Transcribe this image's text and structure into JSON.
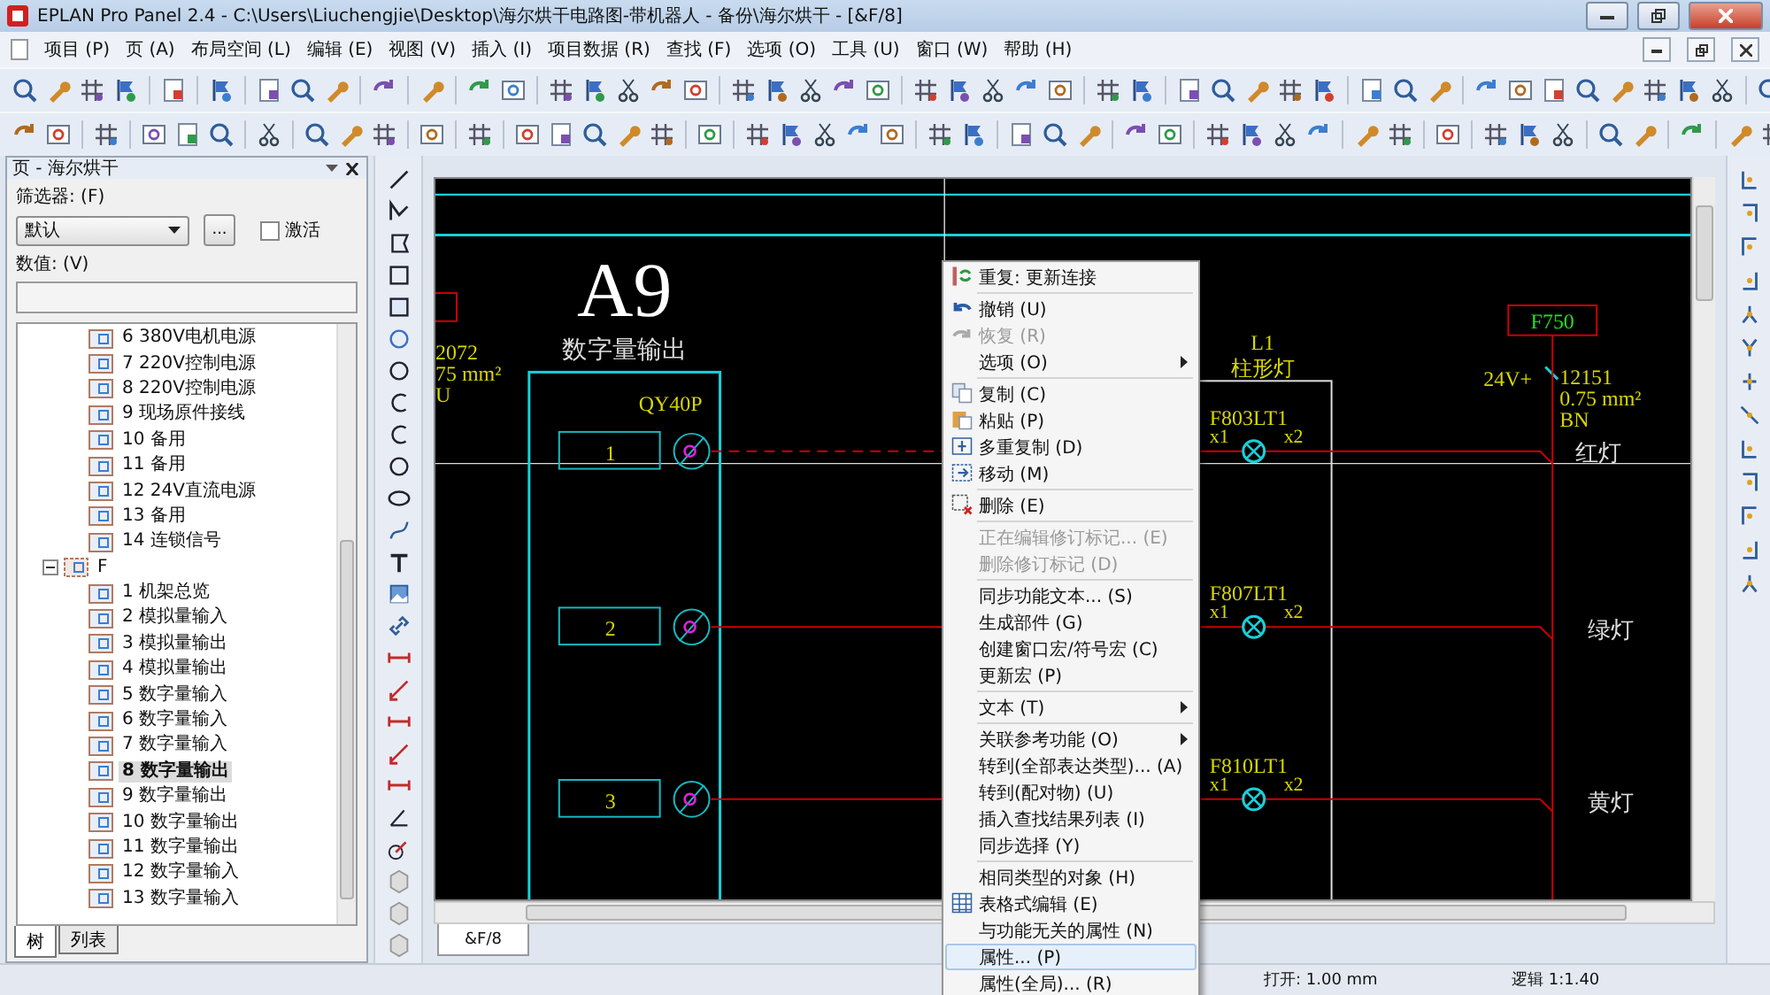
{
  "window": {
    "title": "EPLAN Pro Panel 2.4 - C:\\Users\\Liuchengjie\\Desktop\\海尔烘干电路图-带机器人 - 备份\\海尔烘干 - [&F/8]"
  },
  "menu": [
    "项目 (P)",
    "页 (A)",
    "布局空间 (L)",
    "编辑 (E)",
    "视图 (V)",
    "插入 (I)",
    "项目数据 (R)",
    "查找 (F)",
    "选项 (O)",
    "工具 (U)",
    "窗口 (W)",
    "帮助 (H)"
  ],
  "page_panel": {
    "title": "页 - 海尔烘干",
    "filter_label": "筛选器: (F)",
    "filter_value": "默认",
    "browse_button": "...",
    "activate": {
      "label": "激活",
      "checked": false
    },
    "value_label": "数值: (V)",
    "tree": [
      {
        "children": [
          {
            "label": "6 380V电机电源",
            "selected": false
          },
          {
            "label": "7 220V控制电源",
            "selected": false
          },
          {
            "label": "8 220V控制电源",
            "selected": false
          },
          {
            "label": "9 现场原件接线",
            "selected": false
          },
          {
            "label": "10 备用",
            "selected": false
          },
          {
            "label": "11 备用",
            "selected": false
          },
          {
            "label": "12 24V直流电源",
            "selected": false
          },
          {
            "label": "13 备用",
            "selected": false
          },
          {
            "label": "14 连锁信号",
            "selected": false
          }
        ]
      },
      {
        "label": "F",
        "expanded": true,
        "selected": false,
        "children": [
          {
            "label": "1 机架总览",
            "selected": false
          },
          {
            "label": "2 模拟量输入",
            "selected": false
          },
          {
            "label": "3 模拟量输出",
            "selected": false
          },
          {
            "label": "4 模拟量输出",
            "selected": false
          },
          {
            "label": "5 数字量输入",
            "selected": false
          },
          {
            "label": "6 数字量输入",
            "selected": false
          },
          {
            "label": "7 数字量输入",
            "selected": false
          },
          {
            "label": "8 数字量输出",
            "selected": true
          },
          {
            "label": "9 数字量输出",
            "selected": false
          },
          {
            "label": "10 数字量输出",
            "selected": false
          },
          {
            "label": "11 数字量输出",
            "selected": false
          },
          {
            "label": "12 数字量输入",
            "selected": false
          },
          {
            "label": "13 数字量输入",
            "selected": false
          }
        ]
      }
    ],
    "tabs": [
      {
        "label": "树",
        "selected": true
      },
      {
        "label": "列表",
        "selected": false
      }
    ]
  },
  "canvas": {
    "title": "A9",
    "left_wire_label": [
      "2072",
      "75 mm²",
      "U"
    ],
    "subtitle": "数字量输出",
    "module": {
      "name": "QY40P",
      "slots": [
        "1",
        "2",
        "3"
      ]
    },
    "lamp_group": {
      "name": "L1",
      "type": "柱形灯"
    },
    "lamps": [
      {
        "tag": "F803LT1",
        "pin_1": "x1",
        "pin_2": "x2",
        "label": "红灯"
      },
      {
        "tag": "F807LT1",
        "pin_1": "x1",
        "pin_2": "x2",
        "label": "绿灯"
      },
      {
        "tag": "F810LT1",
        "pin_1": "x1",
        "pin_2": "x2",
        "label": "黄灯"
      }
    ],
    "potential": {
      "tag": "F750",
      "name": "24V+",
      "wire": [
        "12151",
        "0.75 mm²",
        "BN"
      ]
    }
  },
  "document_tab": "&F/8",
  "context_menu": [
    {
      "kind": "item",
      "label": "重复: 更新连接",
      "disabled": false,
      "submenu": false,
      "selected": false
    },
    {
      "kind": "separator"
    },
    {
      "kind": "item",
      "label": "撤销 (U)",
      "disabled": false,
      "submenu": false,
      "selected": false
    },
    {
      "kind": "item",
      "label": "恢复 (R)",
      "disabled": true,
      "submenu": false,
      "selected": false
    },
    {
      "kind": "item",
      "label": "选项 (O)",
      "disabled": false,
      "submenu": true,
      "selected": false
    },
    {
      "kind": "separator"
    },
    {
      "kind": "item",
      "label": "复制 (C)",
      "disabled": false,
      "submenu": false,
      "selected": false
    },
    {
      "kind": "item",
      "label": "粘贴 (P)",
      "disabled": false,
      "submenu": false,
      "selected": false
    },
    {
      "kind": "item",
      "label": "多重复制 (D)",
      "disabled": false,
      "submenu": false,
      "selected": false
    },
    {
      "kind": "item",
      "label": "移动 (M)",
      "disabled": false,
      "submenu": false,
      "selected": false
    },
    {
      "kind": "separator"
    },
    {
      "kind": "item",
      "label": "删除 (E)",
      "disabled": false,
      "submenu": false,
      "selected": false
    },
    {
      "kind": "separator"
    },
    {
      "kind": "item",
      "label": "正在编辑修订标记... (E)",
      "disabled": true,
      "submenu": false,
      "selected": false
    },
    {
      "kind": "item",
      "label": "删除修订标记 (D)",
      "disabled": true,
      "submenu": false,
      "selected": false
    },
    {
      "kind": "separator"
    },
    {
      "kind": "item",
      "label": "同步功能文本... (S)",
      "disabled": false,
      "submenu": false,
      "selected": false
    },
    {
      "kind": "item",
      "label": "生成部件 (G)",
      "disabled": false,
      "submenu": false,
      "selected": false
    },
    {
      "kind": "item",
      "label": "创建窗口宏/符号宏 (C)",
      "disabled": false,
      "submenu": false,
      "selected": false
    },
    {
      "kind": "item",
      "label": "更新宏 (P)",
      "disabled": false,
      "submenu": false,
      "selected": false
    },
    {
      "kind": "separator"
    },
    {
      "kind": "item",
      "label": "文本 (T)",
      "disabled": false,
      "submenu": true,
      "selected": false
    },
    {
      "kind": "separator"
    },
    {
      "kind": "item",
      "label": "关联参考功能 (O)",
      "disabled": false,
      "submenu": true,
      "selected": false
    },
    {
      "kind": "item",
      "label": "转到(全部表达类型)... (A)",
      "disabled": false,
      "submenu": false,
      "selected": false
    },
    {
      "kind": "item",
      "label": "转到(配对物) (U)",
      "disabled": false,
      "submenu": false,
      "selected": false
    },
    {
      "kind": "item",
      "label": "插入查找结果列表 (I)",
      "disabled": false,
      "submenu": false,
      "selected": false
    },
    {
      "kind": "item",
      "label": "同步选择 (Y)",
      "disabled": false,
      "submenu": false,
      "selected": false
    },
    {
      "kind": "separator"
    },
    {
      "kind": "item",
      "label": "相同类型的对象 (H)",
      "disabled": false,
      "submenu": false,
      "selected": false
    },
    {
      "kind": "item",
      "label": "表格式编辑 (E)",
      "disabled": false,
      "submenu": false,
      "selected": false
    },
    {
      "kind": "item",
      "label": "与功能无关的属性 (N)",
      "disabled": false,
      "submenu": false,
      "selected": false
    },
    {
      "kind": "item",
      "label": "属性... (P)",
      "disabled": false,
      "submenu": false,
      "selected": true
    },
    {
      "kind": "item",
      "label": "属性(全局)... (R)",
      "disabled": false,
      "submenu": false,
      "selected": false
    }
  ],
  "status_bar": [
    "打开: 1.00 mm",
    "逻辑 1:1.40"
  ]
}
